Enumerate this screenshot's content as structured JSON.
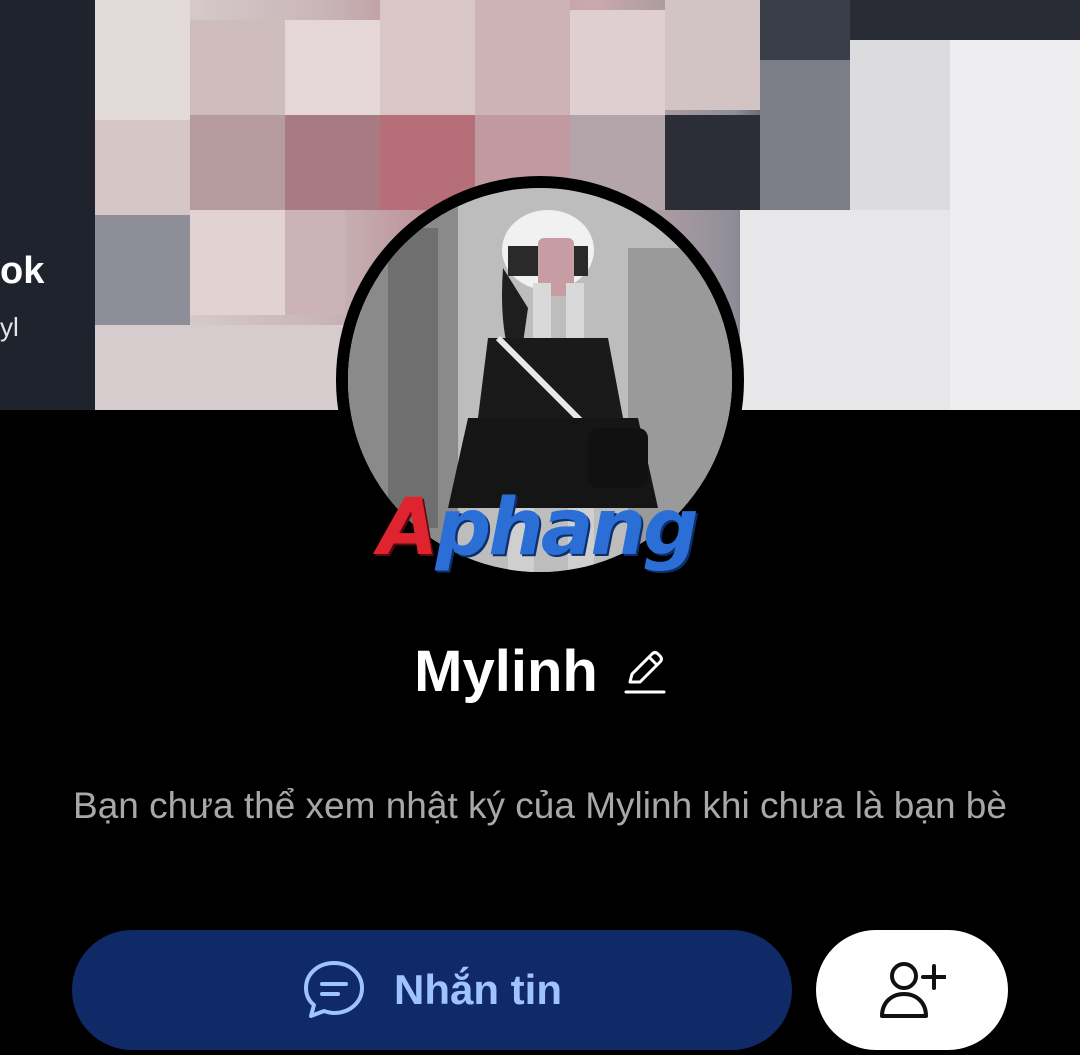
{
  "cover": {
    "partial_text_top": "ok",
    "partial_text_bottom": "yl"
  },
  "avatar": {
    "watermark_first": "A",
    "watermark_rest": "phang"
  },
  "profile": {
    "name": "Mylinh",
    "notice": "Bạn chưa thể xem nhật ký của Mylinh khi chưa là bạn bè"
  },
  "actions": {
    "message_label": "Nhắn tin",
    "message_icon": "chat-bubble-icon",
    "add_friend_icon": "add-friend-icon"
  },
  "colors": {
    "background": "#000000",
    "message_button_bg": "#0f2a66",
    "message_button_text": "#9ec3ff",
    "notice_text": "#a8a8a8",
    "add_button_bg": "#ffffff"
  }
}
